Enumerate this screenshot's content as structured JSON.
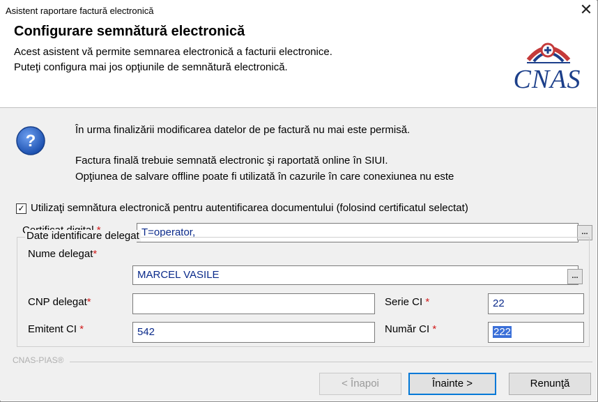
{
  "window": {
    "title": "Asistent raportare factură electronică",
    "close_glyph": "✕"
  },
  "header": {
    "title": "Configurare semnătură electronică",
    "subtitle1": "Acest asistent vă permite semnarea electronică a facturii electronice.",
    "subtitle2": "Puteţi configura mai jos opţiunile de semnătură electronică.",
    "logo_text": "CNAS"
  },
  "message": {
    "icon": "question-icon",
    "line1": "În urma finalizării modificarea datelor de pe factură nu mai este permisă.",
    "line2": "Factura finală trebuie semnată electronic şi raportată online în SIUI.",
    "line3": "Opţiunea de salvare offline poate fi utilizată în cazurile în care conexiunea nu este"
  },
  "signature": {
    "checked": true,
    "check_glyph": "✓",
    "checkbox_label": "Utilizaţi semnătura electronică pentru autentificarea documentului (folosind certificatul selectat)",
    "certificate_label": "Certificat digital",
    "certificate_value": "T=operator,",
    "required_mark": "*",
    "ellipsis": "..."
  },
  "delegate": {
    "group_title": "Date identificare delegat",
    "name_label": "Nume delegat",
    "name_value": "MARCEL VASILE",
    "cnp_label": "CNP delegat",
    "cnp_value": "",
    "serie_label": "Serie CI",
    "serie_value": "22",
    "emitent_label": "Emitent CI",
    "emitent_value": "542",
    "numar_label": "Număr CI",
    "numar_value": "222"
  },
  "footer": {
    "brand": "CNAS-PIAS®",
    "back_label": "< Înapoi",
    "next_label": "Înainte >",
    "cancel_label": "Renunţă"
  },
  "colors": {
    "accent": "#0078d7",
    "logo": "#1c3f8a",
    "required": "#d11a1a",
    "selection": "#3a6fd8"
  }
}
